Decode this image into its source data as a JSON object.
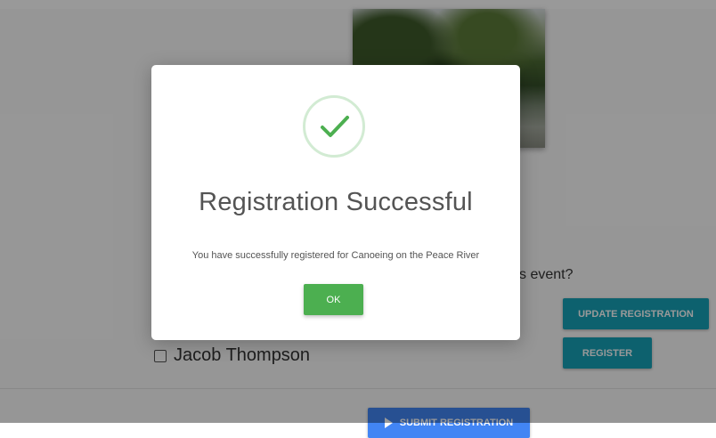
{
  "background": {
    "question_text": "s event?",
    "update_button": "UPDATE REGISTRATION",
    "register_button": "REGISTER",
    "participant_name": "Jacob Thompson",
    "submit_button": "SUBMIT REGISTRATION",
    "photo_icon": "landscape-photo"
  },
  "modal": {
    "icon": "checkmark-icon",
    "title": "Registration Successful",
    "message": "You have successfully registered for Canoeing on the Peace River",
    "ok_button": "OK"
  },
  "colors": {
    "success": "#4caf50",
    "info": "#17a2b8",
    "primary": "#4285f4"
  }
}
